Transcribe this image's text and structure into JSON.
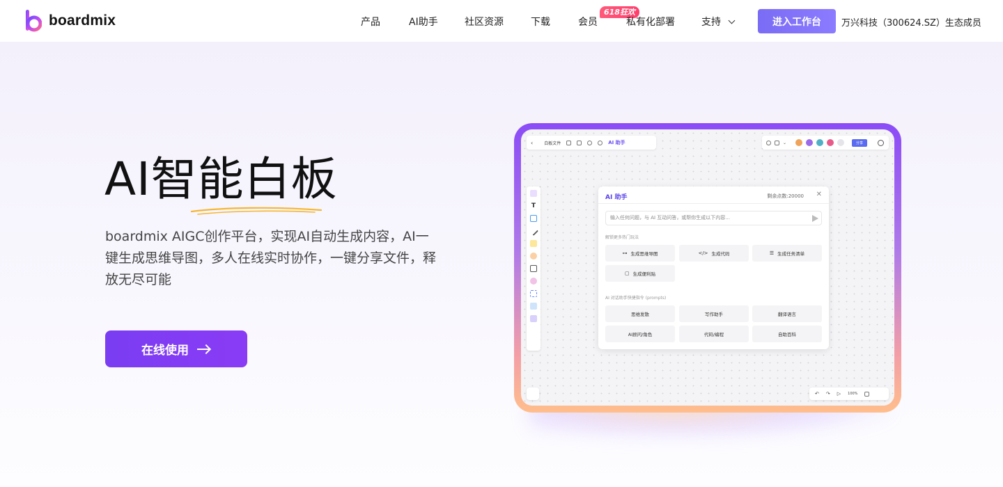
{
  "brand": {
    "name": "boardmix",
    "colors": {
      "accent": "#7b3ef3",
      "nav_cta": "#7f70f6",
      "badge": "#ff3d6b"
    }
  },
  "nav": {
    "items": [
      "产品",
      "AI助手",
      "社区资源",
      "下载",
      "会员",
      "私有化部署",
      "支持"
    ],
    "badge": "618狂欢",
    "cta": "进入工作台",
    "partner": "万兴科技（300624.SZ）生态成员"
  },
  "hero": {
    "title": "AI智能白板",
    "description": "boardmix AIGC创作平台，实现AI自动生成内容，AI一键生成思维导图，多人在线实时协作，一键分享文件，释放无尽可能",
    "cta": "在线使用"
  },
  "mockup": {
    "toolbar": {
      "file": "白板文件",
      "ai": "AI 助手",
      "share": "分享",
      "zoom": "100%"
    },
    "ai_panel": {
      "title": "AI 助手",
      "points": "剩余点数:20000",
      "input_placeholder": "输入任何问题，与 AI 互动问答，或帮你生成以下内容...",
      "section1": "解锁更多热门玩法",
      "actions": [
        "生成思维导图",
        "生成代码",
        "生成任务清单",
        "生成便利贴"
      ],
      "section2": "AI 对话助手快捷指令 (prompts)",
      "prompts": [
        "思维发散",
        "写作助手",
        "翻译语言",
        "AI顾问/角色",
        "代码/编程",
        "自助百科"
      ]
    }
  }
}
